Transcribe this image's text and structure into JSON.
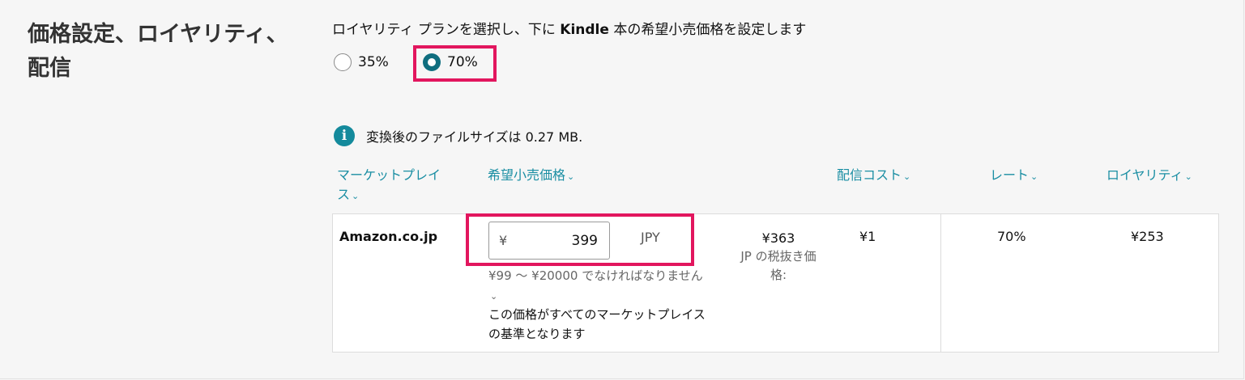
{
  "section": {
    "title": "価格設定、ロイヤリティ、配信"
  },
  "royalty": {
    "intro_before": "ロイヤリティ プランを選択し、下に ",
    "intro_kindle": "Kindle",
    "intro_after": " 本の希望小売価格を設定します",
    "options": [
      {
        "label": "35%",
        "selected": false
      },
      {
        "label": "70%",
        "selected": true
      }
    ]
  },
  "info": {
    "icon": "info-icon",
    "icon_glyph": "i",
    "text": "変換後のファイルサイズは 0.27 MB."
  },
  "columns": {
    "marketplace": "マーケットプレイス",
    "list_price": "希望小売価格",
    "delivery_cost": "配信コスト",
    "rate": "レート",
    "royalty": "ロイヤリティ",
    "caret": "⌄"
  },
  "row": {
    "marketplace": "Amazon.co.jp",
    "currency_symbol": "¥",
    "price_value": "399",
    "currency_code": "JPY",
    "range_note": "¥99 ～ ¥20000 でなければなりません",
    "range_caret": "⌄",
    "base_note": "この価格がすべてのマーケットプレイスの基準となります",
    "excl_tax_price": "¥363",
    "excl_tax_label": "JP の税抜き価格:",
    "delivery_cost": "¥1",
    "rate": "70%",
    "royalty": "¥253"
  },
  "colors": {
    "highlight": "#e2165e",
    "link": "#1a8ea3",
    "radio_selected": "#0f6e7f"
  }
}
